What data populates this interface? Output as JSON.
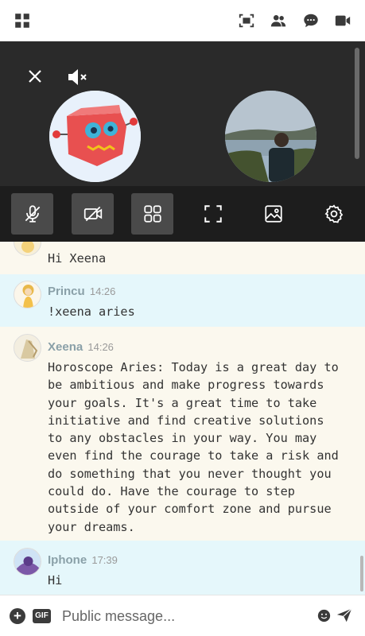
{
  "topbar": {
    "icons": [
      "grid-menu-icon",
      "screen-capture-icon",
      "users-icon",
      "chat-bubble-icon",
      "video-camera-icon"
    ]
  },
  "video": {
    "participants": [
      {
        "kind": "bot-avatar"
      },
      {
        "kind": "camera"
      }
    ]
  },
  "controls": {
    "buttons": [
      {
        "name": "mute-mic-button",
        "icon": "mic-off-icon",
        "active": true
      },
      {
        "name": "camera-off-button",
        "icon": "camera-off-icon",
        "active": true
      },
      {
        "name": "grid-layout-button",
        "icon": "grid-layout-icon",
        "active": true
      },
      {
        "name": "fullscreen-button",
        "icon": "fullscreen-icon",
        "active": false
      },
      {
        "name": "background-image-button",
        "icon": "image-icon",
        "active": false
      },
      {
        "name": "settings-button",
        "icon": "settings-icon",
        "active": false
      }
    ]
  },
  "messages": [
    {
      "author": "",
      "time": "",
      "text": "Hi Xeena"
    },
    {
      "author": "Princu",
      "time": "14:26",
      "text": "!xeena aries"
    },
    {
      "author": "Xeena",
      "time": "14:26",
      "text": "Horoscope Aries: Today is a great day to\nbe ambitious and make progress towards\nyour goals. It's a great time to take\ninitiative and find creative solutions\nto any obstacles in your way. You may\neven find the courage to take a risk and\ndo something that you never thought you\ncould do. Have the courage to step\noutside of your comfort zone and pursue\nyour dreams."
    },
    {
      "author": "Iphone",
      "time": "17:39",
      "text": "Hi"
    }
  ],
  "composer": {
    "plus_label": "+",
    "gif_label": "GIF",
    "placeholder": "Public message...",
    "value": ""
  }
}
